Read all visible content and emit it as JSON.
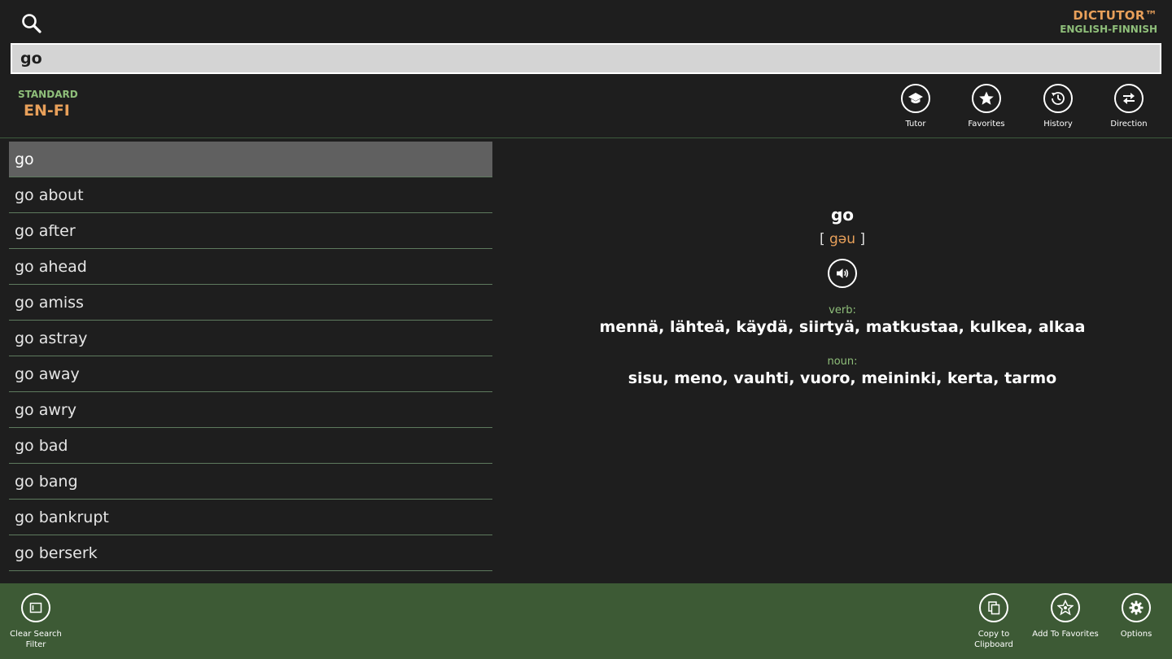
{
  "app": {
    "title": "DICTUTOR™",
    "subtitle": "ENGLISH-FINNISH"
  },
  "search": {
    "value": "go"
  },
  "mode": {
    "label": "STANDARD",
    "value": "EN-FI"
  },
  "top_actions": [
    {
      "label": "Tutor",
      "icon": "graduation-cap-icon"
    },
    {
      "label": "Favorites",
      "icon": "star-icon"
    },
    {
      "label": "History",
      "icon": "history-clock-icon"
    },
    {
      "label": "Direction",
      "icon": "swap-arrows-icon"
    }
  ],
  "word_list": [
    "go",
    "go about",
    "go after",
    "go ahead",
    "go amiss",
    "go astray",
    "go away",
    "go awry",
    "go bad",
    "go bang",
    "go bankrupt",
    "go berserk"
  ],
  "selected_index": 0,
  "entry": {
    "headword": "go",
    "pron_open": "[",
    "pronunciation": "gəu",
    "pron_close": "]",
    "senses": [
      {
        "pos": "verb:",
        "translations": "mennä, lähteä, käydä, siirtyä, matkustaa, kulkea, alkaa"
      },
      {
        "pos": "noun:",
        "translations": "sisu, meno, vauhti, vuoro, meininki, kerta, tarmo"
      }
    ]
  },
  "bottom_actions": {
    "clear": {
      "label": "Clear Search Filter",
      "icon": "clear-filter-icon"
    },
    "copy": {
      "label": "Copy to Clipboard",
      "icon": "copy-icon"
    },
    "add_fav": {
      "label": "Add To Favorites",
      "icon": "star-add-icon"
    },
    "options": {
      "label": "Options",
      "icon": "gear-icon"
    }
  },
  "colors": {
    "background": "#1e1e1e",
    "accent_orange": "#e8a05a",
    "accent_green": "#8fbf7a",
    "appbar": "#3d5a35",
    "selected_row": "#606060"
  }
}
